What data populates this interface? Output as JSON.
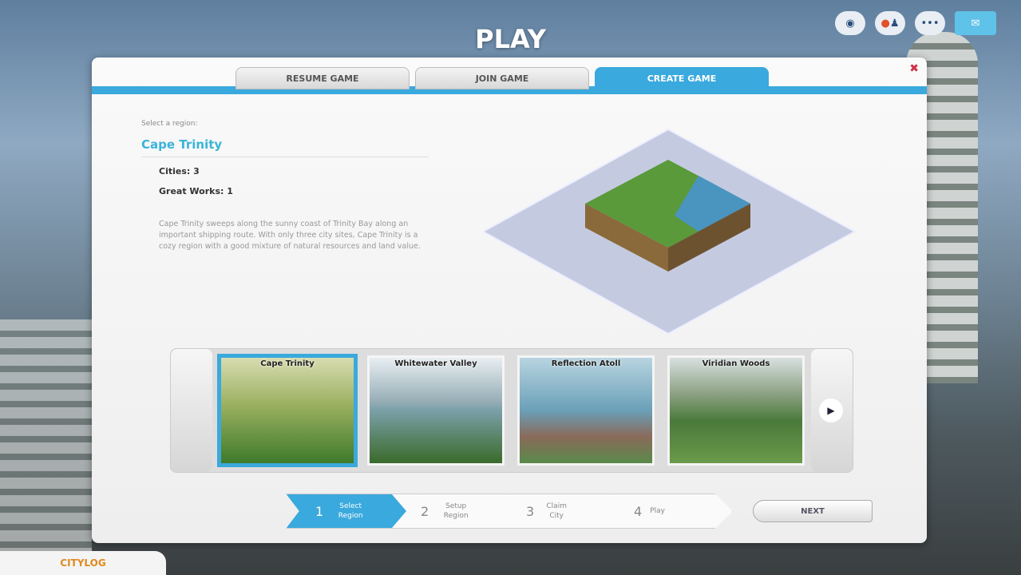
{
  "header": {
    "title": "PLAY"
  },
  "top_icons": [
    "sims-icon",
    "friends-icon",
    "more-icon",
    "notifications-icon"
  ],
  "tabs": [
    {
      "label": "RESUME GAME"
    },
    {
      "label": "JOIN GAME"
    },
    {
      "label": "CREATE GAME",
      "active": true
    }
  ],
  "region": {
    "prompt": "Select a region:",
    "name": "Cape Trinity",
    "cities": "Cities: 3",
    "great_works": "Great Works: 1",
    "description": "Cape Trinity sweeps along the sunny coast of Trinity Bay along an important shipping route. With only three city sites, Cape Trinity is a cozy region with a good mixture of natural resources and land value."
  },
  "regions": [
    {
      "name": "Cape Trinity",
      "selected": true
    },
    {
      "name": "Whitewater Valley"
    },
    {
      "name": "Reflection Atoll"
    },
    {
      "name": "Viridian Woods"
    }
  ],
  "steps": [
    {
      "num": "1",
      "label": "Select Region",
      "active": true
    },
    {
      "num": "2",
      "label": "Setup Region"
    },
    {
      "num": "3",
      "label": "Claim City"
    },
    {
      "num": "4",
      "label": "Play"
    }
  ],
  "next_label": "NEXT",
  "citylog_label": "CITYLOG",
  "colors": {
    "accent": "#3aa9dd",
    "title": "#3ab4d8",
    "citylog": "#e08a20"
  }
}
